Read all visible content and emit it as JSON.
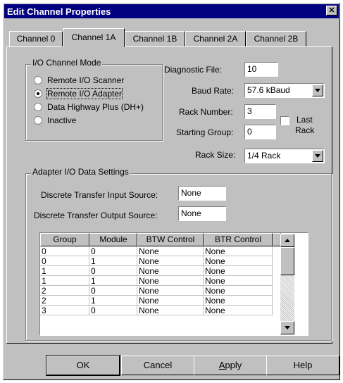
{
  "window": {
    "title": "Edit Channel Properties",
    "close_glyph": "✕"
  },
  "tabs": [
    {
      "label": "Channel 0"
    },
    {
      "label": "Channel 1A",
      "active": true
    },
    {
      "label": "Channel 1B"
    },
    {
      "label": "Channel 2A"
    },
    {
      "label": "Channel 2B"
    }
  ],
  "io_mode": {
    "title": "I/O Channel Mode",
    "options": [
      {
        "label": "Remote I/O Scanner",
        "selected": false
      },
      {
        "label": "Remote I/O Adapter",
        "selected": true
      },
      {
        "label": "Data Highway Plus (DH+)",
        "selected": false
      },
      {
        "label": "Inactive",
        "selected": false
      }
    ]
  },
  "fields": {
    "diagnostic_file_label": "Diagnostic File:",
    "diagnostic_file_value": "10",
    "baud_rate_label": "Baud Rate:",
    "baud_rate_value": "57.6 kBaud",
    "rack_number_label": "Rack Number:",
    "rack_number_value": "3",
    "last_rack_label_1": "Last",
    "last_rack_label_2": "Rack",
    "last_rack_checked": false,
    "starting_group_label": "Starting Group:",
    "starting_group_value": "0",
    "rack_size_label": "Rack Size:",
    "rack_size_value": "1/4 Rack"
  },
  "adapter": {
    "title": "Adapter I/O Data Settings",
    "input_source_label": "Discrete Transfer Input Source:",
    "input_source_value": "None",
    "output_source_label": "Discrete Transfer Output Source:",
    "output_source_value": "None"
  },
  "table": {
    "columns": [
      "Group",
      "Module",
      "BTW Control",
      "BTR Control"
    ],
    "rows": [
      [
        "0",
        "0",
        "None",
        "None"
      ],
      [
        "0",
        "1",
        "None",
        "None"
      ],
      [
        "1",
        "0",
        "None",
        "None"
      ],
      [
        "1",
        "1",
        "None",
        "None"
      ],
      [
        "2",
        "0",
        "None",
        "None"
      ],
      [
        "2",
        "1",
        "None",
        "None"
      ],
      [
        "3",
        "0",
        "None",
        "None"
      ]
    ]
  },
  "buttons": {
    "ok": "OK",
    "cancel": "Cancel",
    "apply": "Apply",
    "apply_mnemonic_first": "A",
    "apply_rest": "pply",
    "help": "Help"
  },
  "icons": {
    "close": "close-icon",
    "dropdown": "chevron-down-icon",
    "scroll_up": "arrow-up-icon",
    "scroll_down": "arrow-down-icon"
  }
}
